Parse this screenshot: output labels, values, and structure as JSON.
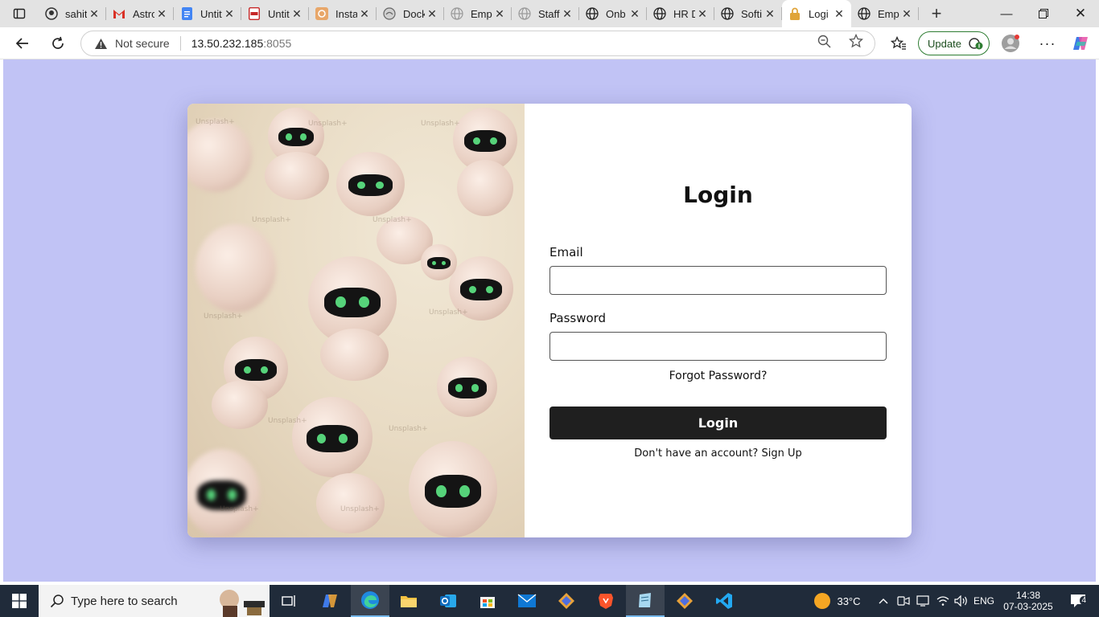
{
  "browser": {
    "tabs": [
      {
        "title": "sahit",
        "icon": "github-icon"
      },
      {
        "title": "Astro",
        "icon": "gmail-icon"
      },
      {
        "title": "Untit",
        "icon": "docs-icon"
      },
      {
        "title": "Untit",
        "icon": "pdf-icon"
      },
      {
        "title": "Insta",
        "icon": "app-icon"
      },
      {
        "title": "Dock",
        "icon": "globe-icon"
      },
      {
        "title": "Emp",
        "icon": "globe-icon"
      },
      {
        "title": "Staff",
        "icon": "globe-icon"
      },
      {
        "title": "Onb",
        "icon": "globe-icon"
      },
      {
        "title": "HR D",
        "icon": "globe-icon"
      },
      {
        "title": "Softi",
        "icon": "globe-icon"
      },
      {
        "title": "Logi",
        "icon": "lock-icon",
        "active": true
      },
      {
        "title": "Emp",
        "icon": "globe-icon"
      }
    ],
    "security_label": "Not secure",
    "url_host": "13.50.232.185",
    "url_port": ":8055",
    "update_label": "Update",
    "accent": "#2e7d32"
  },
  "page": {
    "background": "#c1c3f5",
    "login_title": "Login",
    "email_label": "Email",
    "email_value": "",
    "password_label": "Password",
    "password_value": "",
    "forgot_label": "Forgot Password?",
    "submit_label": "Login",
    "signup_text": "Don't have an account? Sign Up",
    "hero_watermark": "Unsplash+"
  },
  "taskbar": {
    "search_placeholder": "Type here to search",
    "weather": "33°C",
    "language": "ENG",
    "time": "14:38",
    "date": "07-03-2025",
    "notifications": "4"
  }
}
